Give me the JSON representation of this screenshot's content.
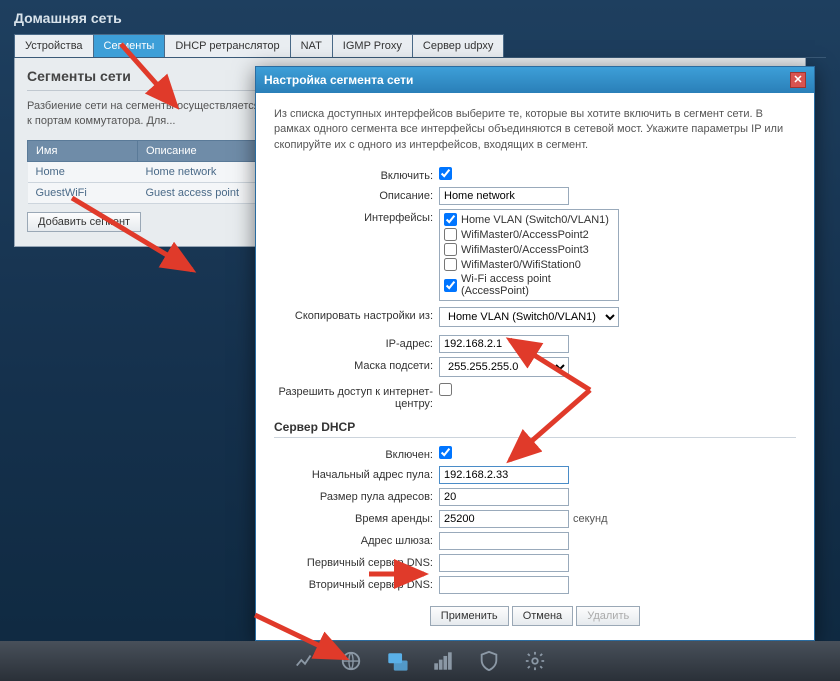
{
  "page_title": "Домашняя сеть",
  "tabs": {
    "items": [
      "Устройства",
      "Сегменты",
      "DHCP ретранслятор",
      "NAT",
      "IGMP Proxy",
      "Сервер udpxy"
    ],
    "active_index": 1
  },
  "panel": {
    "heading": "Сегменты сети",
    "description": "Разбиение сети на сегменты осуществляется... объединяет порты встроенного коммутат... схемы предоставления услуг, для подклю... привязанные к портам коммутатора. Для...",
    "columns": [
      "Имя",
      "Описание"
    ],
    "rows": [
      {
        "name": "Home",
        "desc": "Home network"
      },
      {
        "name": "GuestWiFi",
        "desc": "Guest access point"
      }
    ],
    "add_button": "Добавить сегмент"
  },
  "modal": {
    "title": "Настройка сегмента сети",
    "intro": "Из списка доступных интерфейсов выберите те, которые вы хотите включить в сегмент сети. В рамках одного сегмента все интерфейсы объединяются в сетевой мост. Укажите параметры IP или скопируйте их с одного из интерфейсов, входящих в сегмент.",
    "labels": {
      "enable": "Включить:",
      "description": "Описание:",
      "interfaces": "Интерфейсы:",
      "copy_from": "Скопировать настройки из:",
      "ip": "IP-адрес:",
      "mask": "Маска подсети:",
      "allow_admin": "Разрешить доступ к интернет-центру:",
      "dhcp_section": "Сервер DHCP",
      "dhcp_on": "Включен:",
      "pool_start": "Начальный адрес пула:",
      "pool_size": "Размер пула адресов:",
      "lease": "Время аренды:",
      "gateway": "Адрес шлюза:",
      "dns1": "Первичный сервер DNS:",
      "dns2": "Вторичный сервер DNS:",
      "seconds": "секунд"
    },
    "values": {
      "enable": true,
      "description": "Home network",
      "interfaces": [
        {
          "label": "Home VLAN (Switch0/VLAN1)",
          "checked": true
        },
        {
          "label": "WifiMaster0/AccessPoint2",
          "checked": false
        },
        {
          "label": "WifiMaster0/AccessPoint3",
          "checked": false
        },
        {
          "label": "WifiMaster0/WifiStation0",
          "checked": false
        },
        {
          "label": "Wi-Fi access point (AccessPoint)",
          "checked": true
        }
      ],
      "copy_from": "Home VLAN (Switch0/VLAN1)",
      "ip": "192.168.2.1",
      "mask": "255.255.255.0",
      "allow_admin": false,
      "dhcp_on": true,
      "pool_start": "192.168.2.33",
      "pool_size": "20",
      "lease": "25200",
      "gateway": "",
      "dns1": "",
      "dns2": ""
    },
    "buttons": {
      "apply": "Применить",
      "cancel": "Отмена",
      "delete": "Удалить"
    }
  },
  "dock": {
    "icons": [
      "chart-icon",
      "globe-icon",
      "network-icon",
      "signal-icon",
      "shield-icon",
      "gear-icon"
    ],
    "active_index": 2
  }
}
